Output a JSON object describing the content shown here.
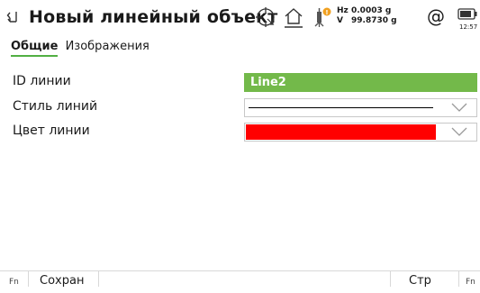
{
  "header": {
    "title": "Новый линейный объект",
    "hz_label": "Hz",
    "hz_value": "0.0003 g",
    "v_label": "V",
    "v_value": "99.8730 g",
    "at_symbol": "@",
    "battery_time": "12:57",
    "icons": [
      "back-icon",
      "target-crosshair-icon",
      "home-station-icon",
      "antenna-alert-icon",
      "battery-icon"
    ]
  },
  "tabs": [
    {
      "label": "Общие",
      "active": true
    },
    {
      "label": "Изображения",
      "active": false
    }
  ],
  "form": {
    "line_id_label": "ID линии",
    "line_id_value": "Line2",
    "line_style_label": "Стиль линий",
    "line_color_label": "Цвет линии",
    "line_color_value": "#ff0000"
  },
  "softkeys": {
    "fn_left": "Fn",
    "save": "Сохран",
    "page": "Стр",
    "fn_right": "Fn"
  },
  "colors": {
    "accent": "#52b043",
    "field_green": "#73b94a",
    "line_color": "#ff0000"
  }
}
